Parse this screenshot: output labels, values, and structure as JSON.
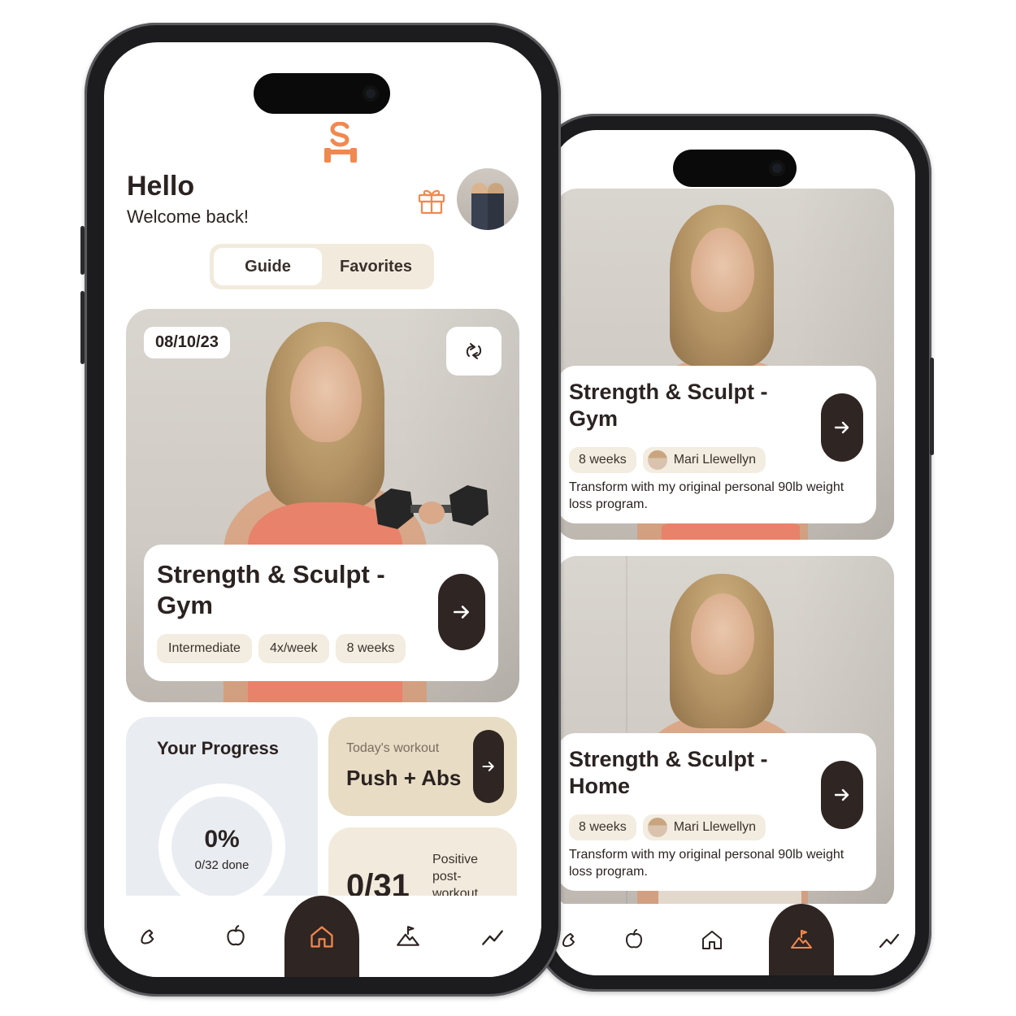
{
  "front": {
    "greeting": "Hello",
    "subtitle": "Welcome back!",
    "tabs": [
      {
        "label": "Guide",
        "active": true
      },
      {
        "label": "Favorites",
        "active": false
      }
    ],
    "hero": {
      "date": "08/10/23",
      "title": "Strength & Sculpt  - Gym",
      "tags": [
        "Intermediate",
        "4x/week",
        "8 weeks"
      ]
    },
    "progress": {
      "title": "Your Progress",
      "percent": "0%",
      "done": "0/32 done",
      "value": 0
    },
    "today": {
      "label": "Today's workout",
      "title": "Push + Abs"
    },
    "posts": {
      "count": "0/31",
      "label": "Positive post-workout days"
    },
    "nav": [
      "dumbbell-icon",
      "apple-icon",
      "home-icon",
      "mountain-flag-icon",
      "trend-icon"
    ],
    "nav_active": "home-icon"
  },
  "back": {
    "plans": [
      {
        "title": "Strength & Sculpt  - Gym",
        "duration": "8 weeks",
        "coach": "Mari Llewellyn",
        "description": "Transform with my original personal 90lb weight loss program."
      },
      {
        "title": "Strength & Sculpt  - Home",
        "duration": "8 weeks",
        "coach": "Mari Llewellyn",
        "description": "Transform with my original personal 90lb weight loss program."
      }
    ],
    "nav": [
      "dumbbell-icon",
      "apple-icon",
      "home-icon",
      "mountain-flag-icon",
      "trend-icon"
    ],
    "nav_active": "mountain-flag-icon"
  },
  "colors": {
    "accent": "#f2884e",
    "dark": "#2f2522",
    "beige": "#f2ebdd",
    "progress_bg": "#e9edf2"
  }
}
